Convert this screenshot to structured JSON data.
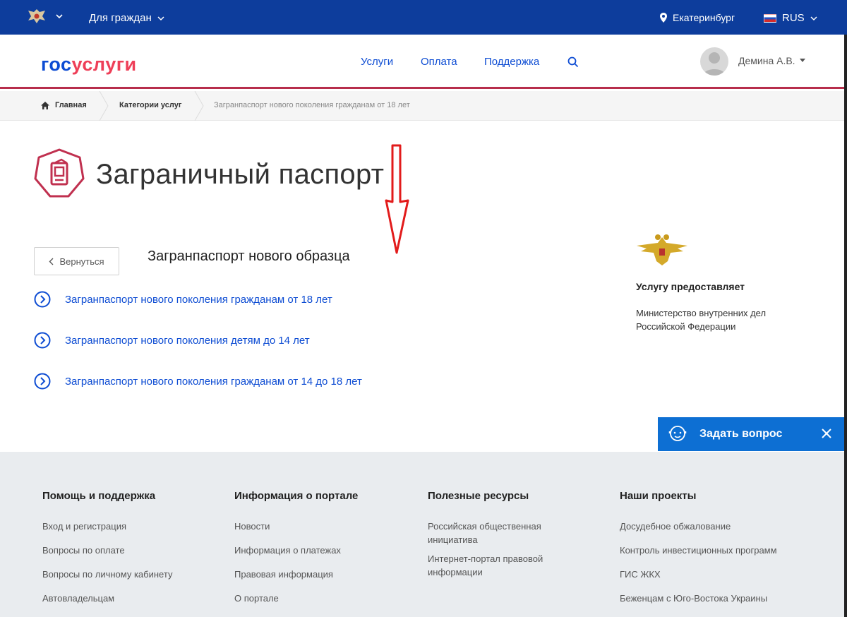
{
  "topbar": {
    "audience": "Для граждан",
    "city": "Екатеринбург",
    "language": "RUS"
  },
  "header": {
    "logo_part1": "гос",
    "logo_part2": "услуги",
    "nav": [
      "Услуги",
      "Оплата",
      "Поддержка"
    ],
    "user_name": "Демина А.В."
  },
  "breadcrumb": {
    "home": "Главная",
    "categories": "Категории услуг",
    "current": "Загранпаспорт нового поколения гражданам от 18 лет"
  },
  "page": {
    "title": "Заграничный паспорт",
    "back_label": "Вернуться",
    "subtitle": "Загранпаспорт нового образца",
    "services": [
      "Загранпаспорт нового поколения гражданам от 18 лет",
      "Загранпаспорт нового поколения детям до 14 лет",
      "Загранпаспорт нового поколения гражданам от 14 до 18 лет"
    ]
  },
  "provider": {
    "heading": "Услугу предоставляет",
    "name": "Министерство внутренних дел Российской Федерации"
  },
  "ask_widget": {
    "label": "Задать вопрос"
  },
  "footer": {
    "columns": [
      {
        "title": "Помощь и поддержка",
        "links": [
          "Вход и регистрация",
          "Вопросы по оплате",
          "Вопросы по личному кабинету",
          "Автовладельцам"
        ]
      },
      {
        "title": "Информация о портале",
        "links": [
          "Новости",
          "Информация о платежах",
          "Правовая информация",
          "О портале"
        ]
      },
      {
        "title": "Полезные ресурсы",
        "links": [
          "Российская общественная инициатива",
          "Интернет-портал правовой информации"
        ]
      },
      {
        "title": "Наши проекты",
        "links": [
          "Досудебное обжалование",
          "Контроль инвестиционных программ",
          "ГИС ЖКХ",
          "Беженцам с Юго-Востока Украины"
        ]
      }
    ]
  },
  "colors": {
    "topbar_bg": "#0d3d9c",
    "link_blue": "#0d4cd3",
    "accent_red": "#ee3f58",
    "ask_blue": "#0d6fd3",
    "footer_bg": "#e9ecef"
  },
  "icons": [
    "emblem-icon",
    "chevron-down-icon",
    "location-pin-icon",
    "flag-icon",
    "search-icon",
    "avatar",
    "home-icon",
    "passport-icon",
    "chevron-left-icon",
    "circle-arrow-icon",
    "mvd-eagle-emblem",
    "support-agent-icon",
    "close-icon"
  ]
}
